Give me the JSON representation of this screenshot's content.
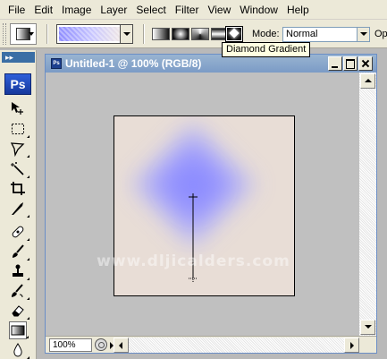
{
  "menu": [
    "File",
    "Edit",
    "Image",
    "Layer",
    "Select",
    "Filter",
    "View",
    "Window",
    "Help"
  ],
  "options": {
    "mode_label": "Mode:",
    "mode_value": "Normal",
    "opacity_label": "Opacity:",
    "gradient_types": [
      "linear-gradient-icon",
      "radial-gradient-icon",
      "angle-gradient-icon",
      "reflected-gradient-icon",
      "diamond-gradient-icon"
    ],
    "selected_gradient_type": "Diamond Gradient",
    "tooltip": "Diamond Gradient"
  },
  "toolbox": {
    "logo": "Ps",
    "tools": [
      "move-tool",
      "marquee-tool",
      "lasso-tool",
      "magic-wand-tool",
      "crop-tool",
      "slice-tool",
      "healing-brush-tool",
      "brush-tool",
      "clone-stamp-tool",
      "history-brush-tool",
      "eraser-tool",
      "gradient-tool",
      "blur-tool"
    ],
    "active_tool": "gradient-tool"
  },
  "document": {
    "title": "Untitled-1 @ 100% (RGB/8)",
    "title_icon": "Ps",
    "zoom": "100%",
    "watermark": "www.dljicalders.com",
    "colors": {
      "foreground": "#8c8cff",
      "background": "#e8ddd6"
    }
  }
}
